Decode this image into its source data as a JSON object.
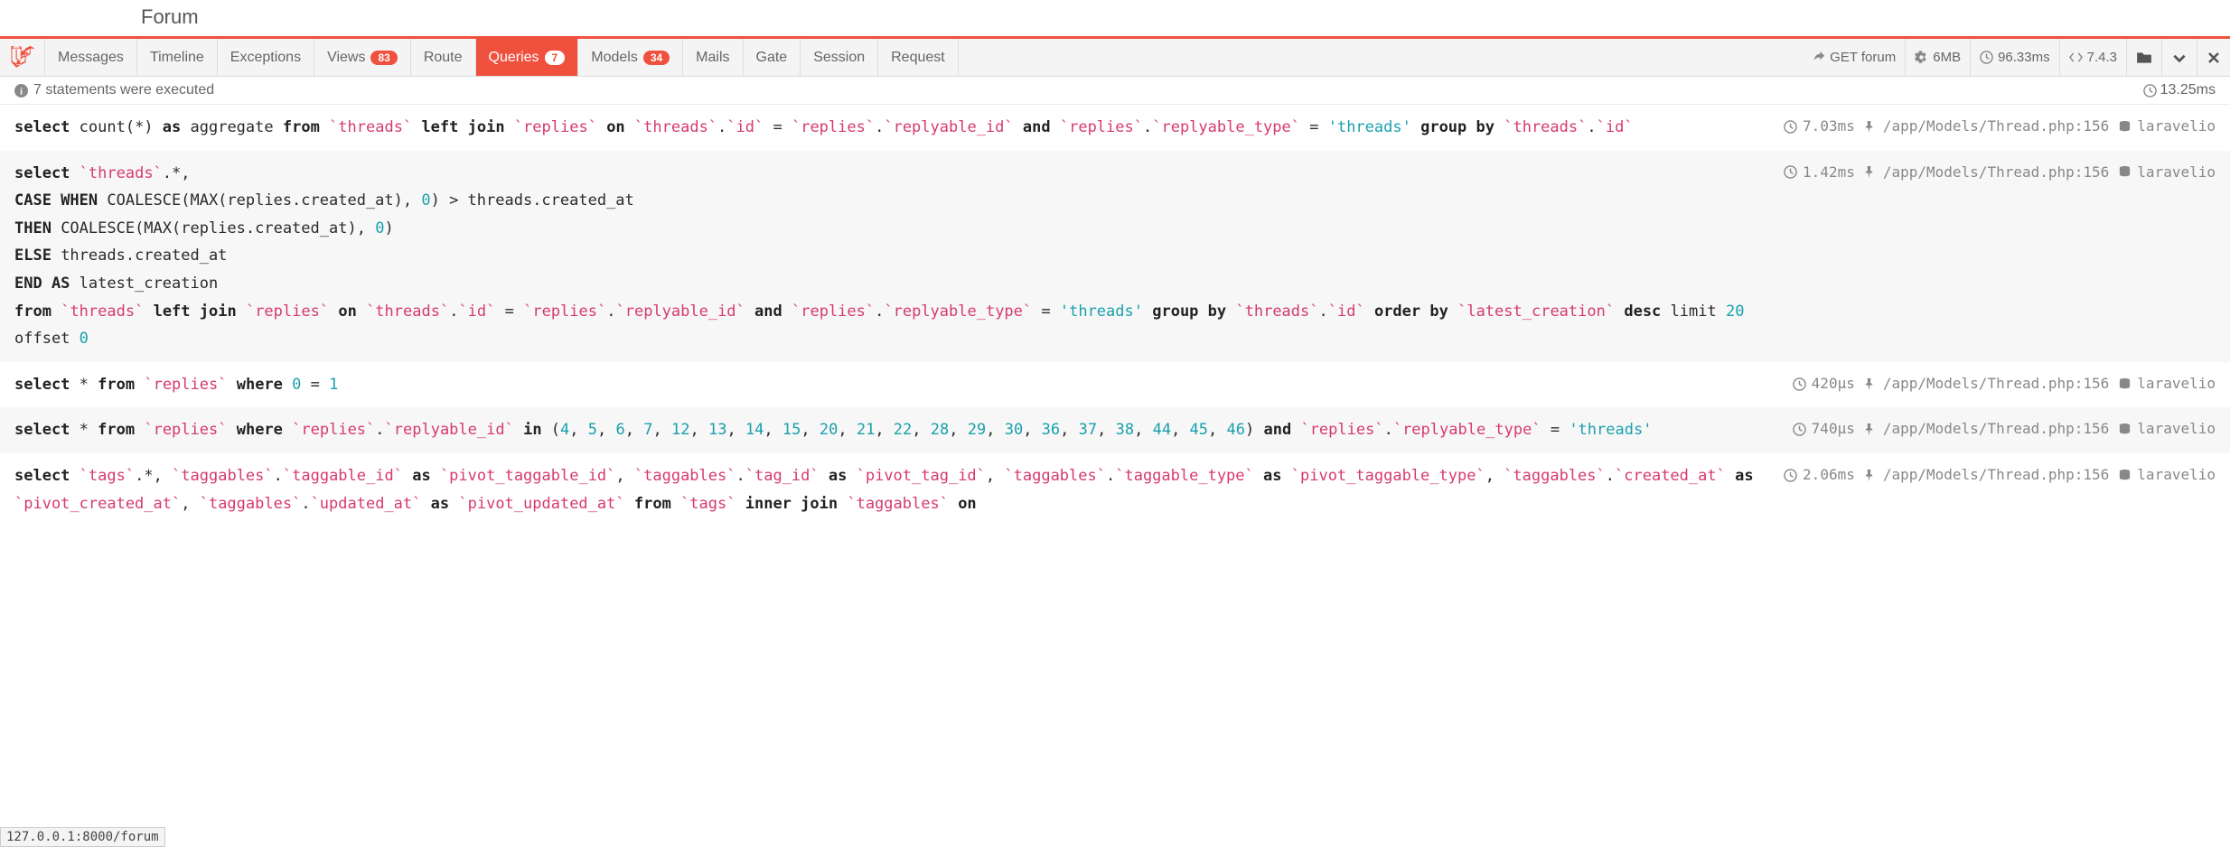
{
  "page": {
    "title": "Forum"
  },
  "tabs": {
    "messages": "Messages",
    "timeline": "Timeline",
    "exceptions": "Exceptions",
    "views": {
      "label": "Views",
      "badge": "83"
    },
    "route": "Route",
    "queries": {
      "label": "Queries",
      "badge": "7"
    },
    "models": {
      "label": "Models",
      "badge": "34"
    },
    "mails": "Mails",
    "gate": "Gate",
    "session": "Session",
    "request": "Request"
  },
  "meta": {
    "method_url": "GET forum",
    "memory": "6MB",
    "time": "96.33ms",
    "php": "7.4.3"
  },
  "summary": {
    "text": "7 statements were executed",
    "total_time": "13.25ms"
  },
  "queries": [
    {
      "time": "7.03ms",
      "file": "/app/Models/Thread.php:156",
      "conn": "laravelio",
      "sql_html": "<span class='kw'>select</span> count(*) <span class='kw'>as</span> aggregate <span class='kw'>from</span> <span class='ident'>`threads`</span> <span class='kw'>left join</span> <span class='ident'>`replies`</span> <span class='kw'>on</span> <span class='ident'>`threads`</span>.<span class='ident'>`id`</span> = <span class='ident'>`replies`</span>.<span class='ident'>`replyable_id`</span> <span class='kw'>and</span> <span class='ident'>`replies`</span>.<span class='ident'>`replyable_type`</span> = <span class='lit'>'threads'</span> <span class='kw'>group by</span> <span class='ident'>`threads`</span>.<span class='ident'>`id`</span>"
    },
    {
      "time": "1.42ms",
      "file": "/app/Models/Thread.php:156",
      "conn": "laravelio",
      "sql_html": "<span class='kw'>select</span> <span class='ident'>`threads`</span>.*,\n<span class='kw'>CASE WHEN</span> COALESCE(MAX(replies.created_at), <span class='lit'>0</span>) > threads.created_at\n<span class='kw'>THEN</span> COALESCE(MAX(replies.created_at), <span class='lit'>0</span>)\n<span class='kw'>ELSE</span> threads.created_at\n<span class='kw'>END AS</span> latest_creation\n<span class='kw'>from</span> <span class='ident'>`threads`</span> <span class='kw'>left join</span> <span class='ident'>`replies`</span> <span class='kw'>on</span> <span class='ident'>`threads`</span>.<span class='ident'>`id`</span> = <span class='ident'>`replies`</span>.<span class='ident'>`replyable_id`</span> <span class='kw'>and</span> <span class='ident'>`replies`</span>.<span class='ident'>`replyable_type`</span> = <span class='lit'>'threads'</span> <span class='kw'>group by</span> <span class='ident'>`threads`</span>.<span class='ident'>`id`</span> <span class='kw'>order by</span> <span class='ident'>`latest_creation`</span> <span class='kw'>desc</span> limit <span class='lit'>20</span> offset <span class='lit'>0</span>"
    },
    {
      "time": "420µs",
      "file": "/app/Models/Thread.php:156",
      "conn": "laravelio",
      "sql_html": "<span class='kw'>select</span> * <span class='kw'>from</span> <span class='ident'>`replies`</span> <span class='kw'>where</span> <span class='lit'>0</span> = <span class='lit'>1</span>"
    },
    {
      "time": "740µs",
      "file": "/app/Models/Thread.php:156",
      "conn": "laravelio",
      "sql_html": "<span class='kw'>select</span> * <span class='kw'>from</span> <span class='ident'>`replies`</span> <span class='kw'>where</span> <span class='ident'>`replies`</span>.<span class='ident'>`replyable_id`</span> <span class='kw'>in</span> (<span class='lit'>4</span>, <span class='lit'>5</span>, <span class='lit'>6</span>, <span class='lit'>7</span>, <span class='lit'>12</span>, <span class='lit'>13</span>, <span class='lit'>14</span>, <span class='lit'>15</span>, <span class='lit'>20</span>, <span class='lit'>21</span>, <span class='lit'>22</span>, <span class='lit'>28</span>, <span class='lit'>29</span>, <span class='lit'>30</span>, <span class='lit'>36</span>, <span class='lit'>37</span>, <span class='lit'>38</span>, <span class='lit'>44</span>, <span class='lit'>45</span>, <span class='lit'>46</span>) <span class='kw'>and</span> <span class='ident'>`replies`</span>.<span class='ident'>`replyable_type`</span> = <span class='lit'>'threads'</span>"
    },
    {
      "time": "2.06ms",
      "file": "/app/Models/Thread.php:156",
      "conn": "laravelio",
      "sql_html": "<span class='kw'>select</span> <span class='ident'>`tags`</span>.*, <span class='ident'>`taggables`</span>.<span class='ident'>`taggable_id`</span> <span class='kw'>as</span> <span class='ident'>`pivot_taggable_id`</span>, <span class='ident'>`taggables`</span>.<span class='ident'>`tag_id`</span> <span class='kw'>as</span> <span class='ident'>`pivot_tag_id`</span>, <span class='ident'>`taggables`</span>.<span class='ident'>`taggable_type`</span> <span class='kw'>as</span> <span class='ident'>`pivot_taggable_type`</span>, <span class='ident'>`taggables`</span>.<span class='ident'>`created_at`</span> <span class='kw'>as</span> <span class='ident'>`pivot_created_at`</span>, <span class='ident'>`taggables`</span>.<span class='ident'>`updated_at`</span> <span class='kw'>as</span> <span class='ident'>`pivot_updated_at`</span> <span class='kw'>from</span> <span class='ident'>`tags`</span> <span class='kw'>inner join</span> <span class='ident'>`taggables`</span> <span class='kw'>on</span>"
    }
  ],
  "status_url": "127.0.0.1:8000/forum"
}
